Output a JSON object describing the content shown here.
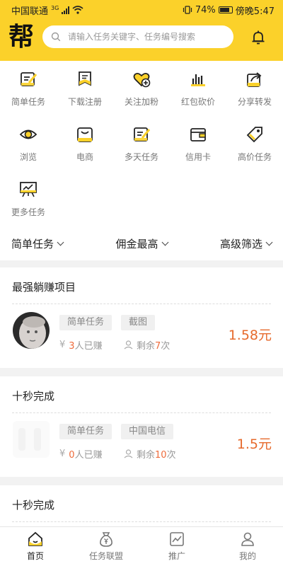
{
  "status_bar": {
    "carrier": "中国联通",
    "network": "3G",
    "battery": "74%",
    "time": "傍晚5:47"
  },
  "header": {
    "logo_text": "帮",
    "search_placeholder": "请输入任务关键字、任务编号搜索",
    "brand_color": "#fbd12a"
  },
  "categories": [
    {
      "label": "简单任务",
      "icon": "checklist-icon",
      "active": true
    },
    {
      "label": "下载注册",
      "icon": "bookmark-icon",
      "active": false
    },
    {
      "label": "关注加粉",
      "icon": "heart-plus-icon",
      "active": false
    },
    {
      "label": "红包砍价",
      "icon": "bar-chart-icon",
      "active": false
    },
    {
      "label": "分享转发",
      "icon": "share-icon",
      "active": false
    },
    {
      "label": "浏览",
      "icon": "eye-icon",
      "active": false
    },
    {
      "label": "电商",
      "icon": "shopping-bag-icon",
      "active": false
    },
    {
      "label": "多天任务",
      "icon": "checklist-icon",
      "active": false
    },
    {
      "label": "信用卡",
      "icon": "wallet-icon",
      "active": false
    },
    {
      "label": "高价任务",
      "icon": "price-tag-icon",
      "active": false
    },
    {
      "label": "更多任务",
      "icon": "presentation-icon",
      "active": false
    }
  ],
  "filters": {
    "type": "简单任务",
    "sort": "佣金最高",
    "advanced": "高级筛选"
  },
  "sections": [
    {
      "title": "最强躺赚项目",
      "task": {
        "tags": [
          "简单任务",
          "截图"
        ],
        "earned_count": "3",
        "earned_suffix": "人已赚",
        "remaining_prefix": "剩余",
        "remaining_count": "7",
        "remaining_suffix": "次",
        "price": "1.58元"
      }
    },
    {
      "title": "十秒完成",
      "task": {
        "tags": [
          "简单任务",
          "中国电信"
        ],
        "earned_count": "0",
        "earned_suffix": "人已赚",
        "remaining_prefix": "剩余",
        "remaining_count": "10",
        "remaining_suffix": "次",
        "price": "1.5元"
      }
    },
    {
      "title": "十秒完成"
    }
  ],
  "tabs": [
    {
      "label": "首页",
      "icon": "home-icon",
      "active": true
    },
    {
      "label": "任务联盟",
      "icon": "money-bag-icon",
      "active": false
    },
    {
      "label": "推广",
      "icon": "trend-chart-icon",
      "active": false
    },
    {
      "label": "我的",
      "icon": "user-icon",
      "active": false
    }
  ],
  "colors": {
    "accent": "#fbd12a",
    "price": "#e66a2c",
    "count": "#ee6b3b"
  }
}
